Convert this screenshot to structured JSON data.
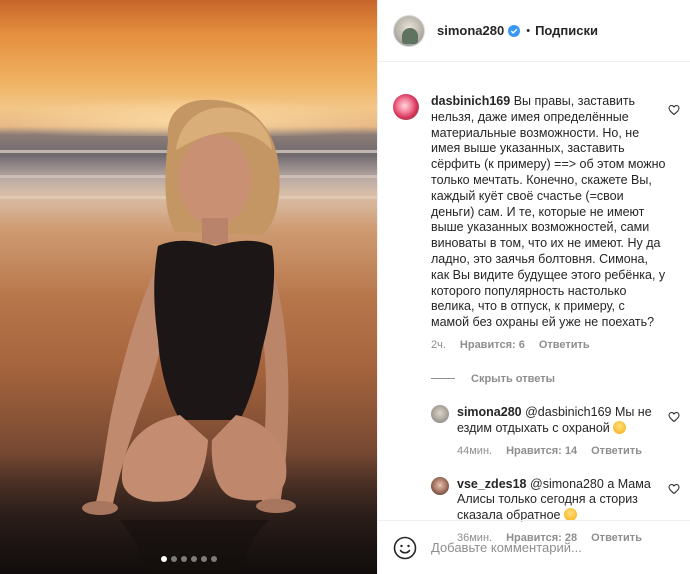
{
  "header": {
    "username": "simona280",
    "separator": "•",
    "follow_label": "Подписки"
  },
  "photo": {
    "carousel_count": 6,
    "carousel_active_index": 0
  },
  "comment": {
    "username": "dasbinich169",
    "text": "Вы правы, заставить нельзя, даже имея определённые материальные возможности. Но, не имея выше указанных, заставить сёрфить (к примеру) ==> об этом можно только мечтать. Конечно, скажете Вы, каждый куёт своё счастье (=свои деньги) сам. И те, которые не имеют выше указанных возможностей, сами виноваты в том, что их не имеют. Ну да ладно, это заячья болтовня. Симона, как Вы видите будущее этого ребёнка, у которого популярность настолько велика, что в отпуск, к примеру, с мамой без охраны ей уже не поехать?",
    "time": "2ч.",
    "likes": "Нравится: 6",
    "reply_label": "Ответить"
  },
  "hide_replies_label": "Скрыть ответы",
  "replies": [
    {
      "username": "simona280",
      "text": "@dasbinich169 Мы не ездим отдыхать с охраной",
      "emoji": "laughing-face",
      "time": "44мин.",
      "likes": "Нравится: 14",
      "reply_label": "Ответить"
    },
    {
      "username": "vse_zdes18",
      "text": "@simona280 а Мама Алисы только сегодня а сториз сказала обратное",
      "emoji": "smiling-face",
      "time": "36мин.",
      "likes": "Нравится: 28",
      "reply_label": "Ответить"
    }
  ],
  "add_comment": {
    "placeholder": "Добавьте комментарий..."
  },
  "colors": {
    "verified": "#3897f0",
    "text": "#262626",
    "muted": "#8e8e8e",
    "border": "#efefef"
  }
}
